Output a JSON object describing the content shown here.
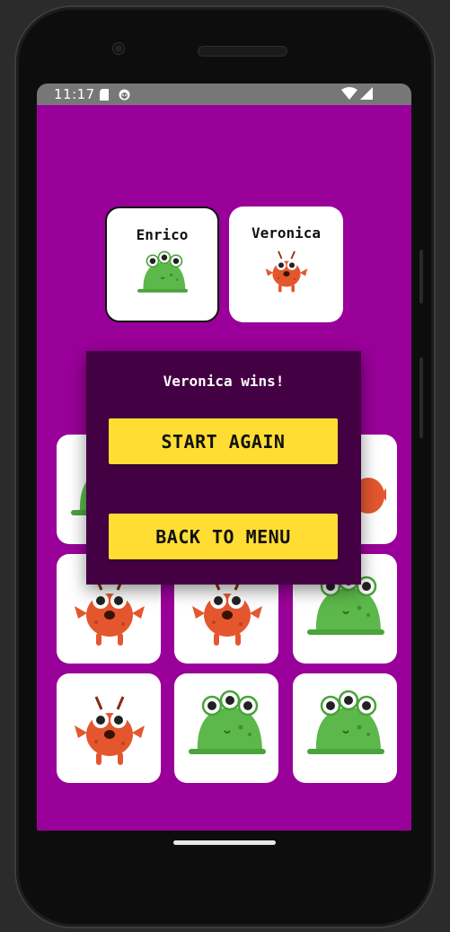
{
  "status_bar": {
    "time": "11:17",
    "icons": [
      "sd-card-icon",
      "android-icon",
      "wifi-icon",
      "signal-icon"
    ]
  },
  "players": [
    {
      "name": "Enrico",
      "monster": "green-slime-monster",
      "active": true
    },
    {
      "name": "Veronica",
      "monster": "orange-crab-monster",
      "active": false
    }
  ],
  "board": {
    "tiles": [
      "green-slime-monster",
      "hidden",
      "orange-crab-monster",
      "orange-crab-monster",
      "orange-crab-monster",
      "green-slime-monster",
      "orange-crab-monster",
      "green-slime-monster",
      "green-slime-monster"
    ]
  },
  "dialog": {
    "message": "Veronica wins!",
    "start_again_label": "START AGAIN",
    "back_to_menu_label": "BACK TO MENU"
  },
  "colors": {
    "background": "#990099",
    "dialog": "#430043",
    "button": "#ffdd33",
    "status_bar": "#777777"
  }
}
